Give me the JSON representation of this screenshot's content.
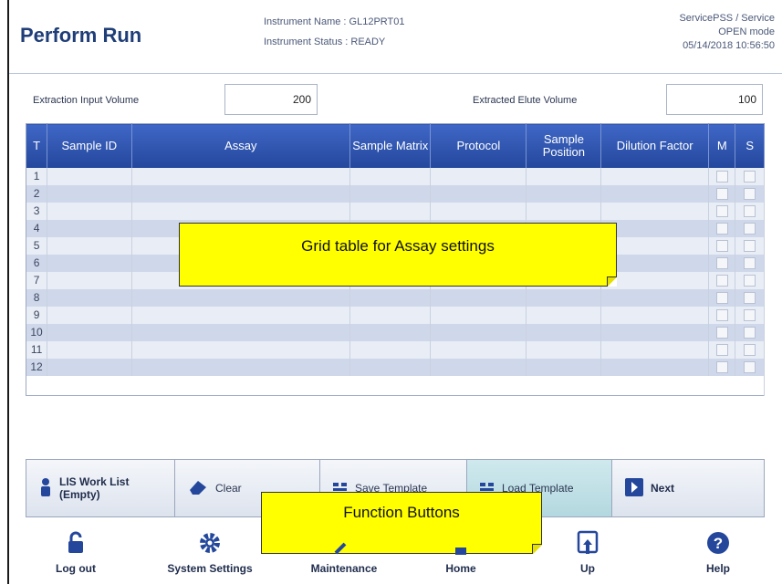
{
  "header": {
    "title": "Perform Run",
    "instrument_name": "Instrument Name : GL12PRT01",
    "instrument_status": "Instrument Status : READY",
    "user": "ServicePSS / Service",
    "mode": "OPEN mode",
    "datetime": "05/14/2018 10:56:50"
  },
  "volumes": {
    "input_label": "Extraction Input Volume",
    "input_value": "200",
    "elute_label": "Extracted Elute Volume",
    "elute_value": "100"
  },
  "grid": {
    "columns": [
      "T",
      "Sample ID",
      "Assay",
      "Sample Matrix",
      "Protocol",
      "Sample Position",
      "Dilution Factor",
      "M",
      "S"
    ],
    "rows": [
      "1",
      "2",
      "3",
      "4",
      "5",
      "6",
      "7",
      "8",
      "9",
      "10",
      "11",
      "12"
    ]
  },
  "callouts": {
    "grid": "Grid table for Assay settings",
    "buttons": "Function Buttons"
  },
  "function_buttons": {
    "lis_line1": "LIS Work List",
    "lis_line2": "(Empty)",
    "clear": "Clear",
    "save_template": "Save Template",
    "load_template": "Load Template",
    "next": "Next"
  },
  "nav": {
    "logout": "Log out",
    "system_settings": "System Settings",
    "maintenance": "Maintenance",
    "home": "Home",
    "up": "Up",
    "help": "Help"
  },
  "colors": {
    "header_blue": "#24479c",
    "row_light": "#e9edf5",
    "row_dark": "#cfd8ea",
    "callout_yellow": "#ffff00",
    "load_button": "#b3d8df"
  }
}
